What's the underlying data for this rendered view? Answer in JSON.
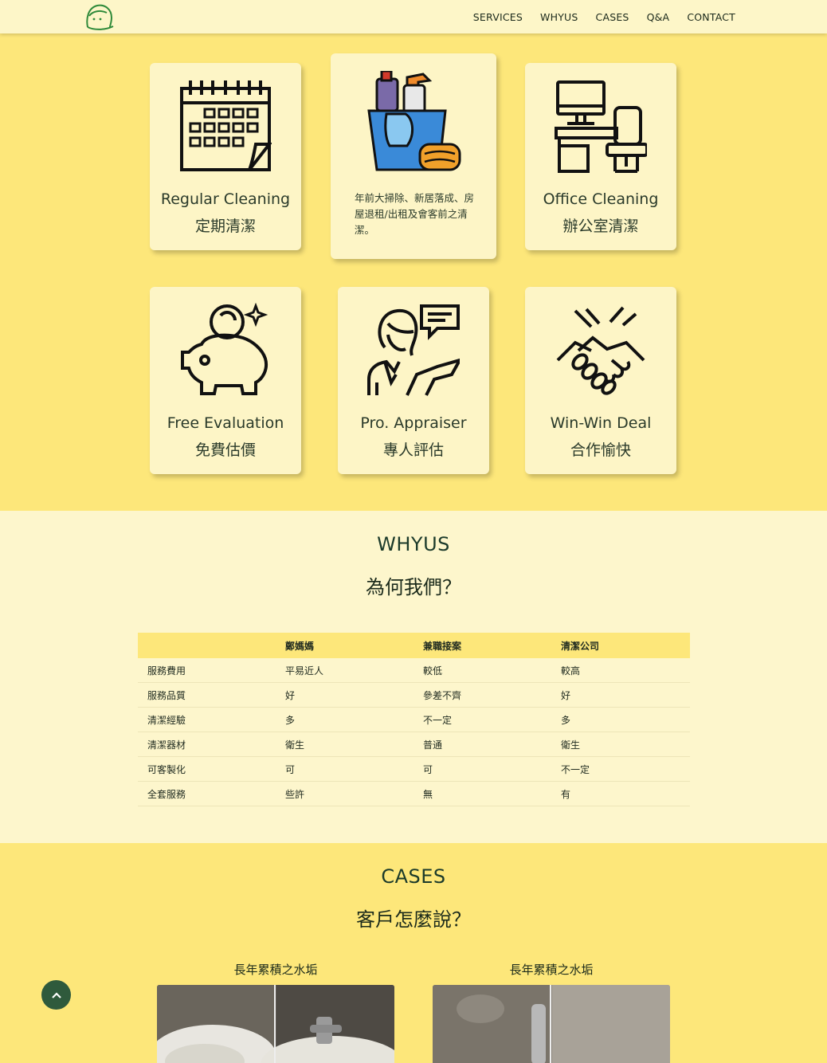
{
  "nav": {
    "links": [
      "SERVICES",
      "WHYUS",
      "CASES",
      "Q&A",
      "CONTACT"
    ]
  },
  "services": {
    "cards": [
      {
        "title": "Regular Cleaning",
        "sub": "定期清潔",
        "icon": "calendar-icon"
      },
      {
        "desc": "年前大掃除、新居落成、房屋退租/出租及會客前之清潔。",
        "icon": "cleaning-bucket-icon"
      },
      {
        "title": "Office Cleaning",
        "sub": "辦公室清潔",
        "icon": "office-desk-icon"
      },
      {
        "title": "Free Evaluation",
        "sub": "免費估價",
        "icon": "piggy-bank-icon"
      },
      {
        "title": "Pro. Appraiser",
        "sub": "專人評估",
        "icon": "appraiser-icon"
      },
      {
        "title": "Win-Win Deal",
        "sub": "合作愉快",
        "icon": "handshake-icon"
      }
    ]
  },
  "whyus": {
    "title": "WHYUS",
    "subtitle": "為何我們？",
    "table": {
      "headers": [
        "",
        "鄭媽媽",
        "兼職接案",
        "清潔公司"
      ],
      "rows": [
        [
          "服務費用",
          "平易近人",
          "較低",
          "較高"
        ],
        [
          "服務品質",
          "好",
          "參差不齊",
          "好"
        ],
        [
          "清潔經驗",
          "多",
          "不一定",
          "多"
        ],
        [
          "清潔器材",
          "衛生",
          "普通",
          "衛生"
        ],
        [
          "可客製化",
          "可",
          "可",
          "不一定"
        ],
        [
          "全套服務",
          "些許",
          "無",
          "有"
        ]
      ]
    }
  },
  "cases": {
    "title": "CASES",
    "subtitle": "客戶怎麼說？",
    "items": [
      {
        "title": "長年累積之水垢"
      },
      {
        "title": "長年累積之水垢"
      }
    ]
  },
  "colors": {
    "yellow": "#fde77a",
    "cream": "#fdf6cc",
    "green": "#2f5a3c"
  }
}
